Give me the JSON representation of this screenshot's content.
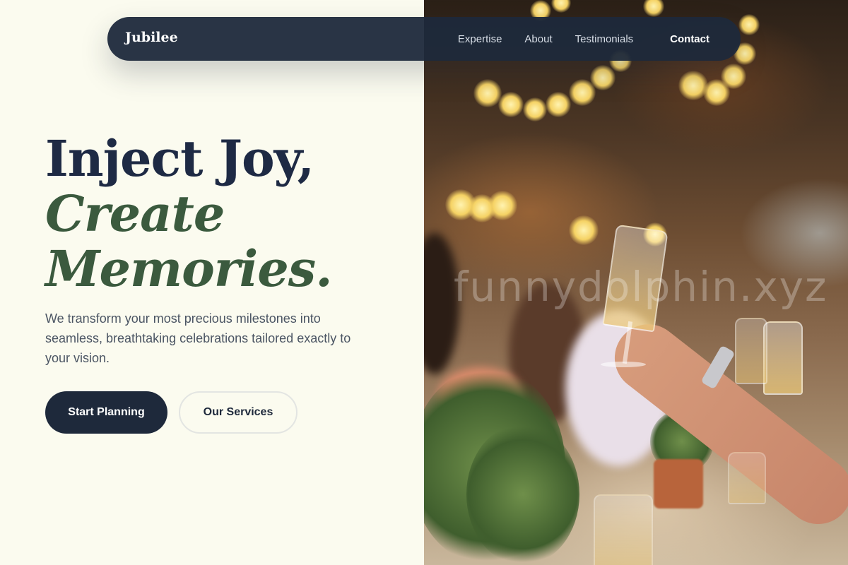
{
  "nav": {
    "brand": "Jubilee",
    "links": [
      "Expertise",
      "About",
      "Testimonials"
    ],
    "contact": "Contact"
  },
  "hero": {
    "title_line1": "Inject Joy,",
    "title_line2": "Create",
    "title_line3": "Memories.",
    "description": "We transform your most precious milestones into seamless, breathtaking celebrations tailored exactly to your vision.",
    "primary_button": "Start Planning",
    "secondary_button": "Our Services"
  },
  "photo": {
    "watermark": "funnydolphin.xyz"
  },
  "colors": {
    "background": "#fbfbef",
    "navy": "#1e293b",
    "heading": "#1e2a44",
    "green_accent": "#3b5a3e",
    "body_text": "#4b5563"
  }
}
